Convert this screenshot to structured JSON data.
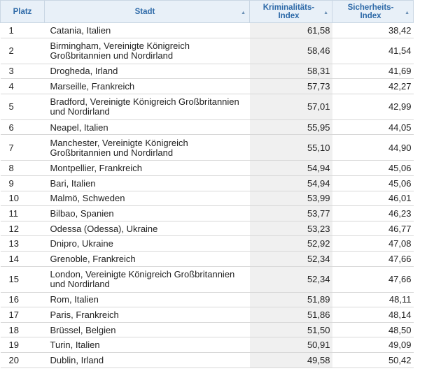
{
  "table": {
    "headers": {
      "rank": "Platz",
      "city": "Stadt",
      "crime": "Kriminalitäts-\nIndex",
      "safety": "Sicherheits-\nIndex"
    },
    "rows": [
      {
        "rank": "1",
        "city": "Catania, Italien",
        "crime": "61,58",
        "safety": "38,42"
      },
      {
        "rank": "2",
        "city": "Birmingham, Vereinigte Königreich\nGroßbritannien und Nordirland",
        "crime": "58,46",
        "safety": "41,54"
      },
      {
        "rank": "3",
        "city": "Drogheda, Irland",
        "crime": "58,31",
        "safety": "41,69"
      },
      {
        "rank": "4",
        "city": "Marseille, Frankreich",
        "crime": "57,73",
        "safety": "42,27"
      },
      {
        "rank": "5",
        "city": "Bradford, Vereinigte Königreich Großbritannien\nund Nordirland",
        "crime": "57,01",
        "safety": "42,99"
      },
      {
        "rank": "6",
        "city": "Neapel, Italien",
        "crime": "55,95",
        "safety": "44,05"
      },
      {
        "rank": "7",
        "city": "Manchester, Vereinigte Königreich\nGroßbritannien und Nordirland",
        "crime": "55,10",
        "safety": "44,90"
      },
      {
        "rank": "8",
        "city": "Montpellier, Frankreich",
        "crime": "54,94",
        "safety": "45,06"
      },
      {
        "rank": "9",
        "city": "Bari, Italien",
        "crime": "54,94",
        "safety": "45,06"
      },
      {
        "rank": "10",
        "city": "Malmö, Schweden",
        "crime": "53,99",
        "safety": "46,01"
      },
      {
        "rank": "11",
        "city": "Bilbao, Spanien",
        "crime": "53,77",
        "safety": "46,23"
      },
      {
        "rank": "12",
        "city": "Odessa (Odessa), Ukraine",
        "crime": "53,23",
        "safety": "46,77"
      },
      {
        "rank": "13",
        "city": "Dnipro, Ukraine",
        "crime": "52,92",
        "safety": "47,08"
      },
      {
        "rank": "14",
        "city": "Grenoble, Frankreich",
        "crime": "52,34",
        "safety": "47,66"
      },
      {
        "rank": "15",
        "city": "London, Vereinigte Königreich Großbritannien\nund Nordirland",
        "crime": "52,34",
        "safety": "47,66"
      },
      {
        "rank": "16",
        "city": "Rom, Italien",
        "crime": "51,89",
        "safety": "48,11"
      },
      {
        "rank": "17",
        "city": "Paris, Frankreich",
        "crime": "51,86",
        "safety": "48,14"
      },
      {
        "rank": "18",
        "city": "Brüssel, Belgien",
        "crime": "51,50",
        "safety": "48,50"
      },
      {
        "rank": "19",
        "city": "Turin, Italien",
        "crime": "50,91",
        "safety": "49,09"
      },
      {
        "rank": "20",
        "city": "Dublin, Irland",
        "crime": "49,58",
        "safety": "50,42"
      }
    ]
  },
  "icons": {
    "sort": "sort-caret-up-icon"
  },
  "colors": {
    "header_bg": "#e8f0f8",
    "header_text": "#2e6aa8",
    "crime_col_bg": "#f0f0f0"
  }
}
